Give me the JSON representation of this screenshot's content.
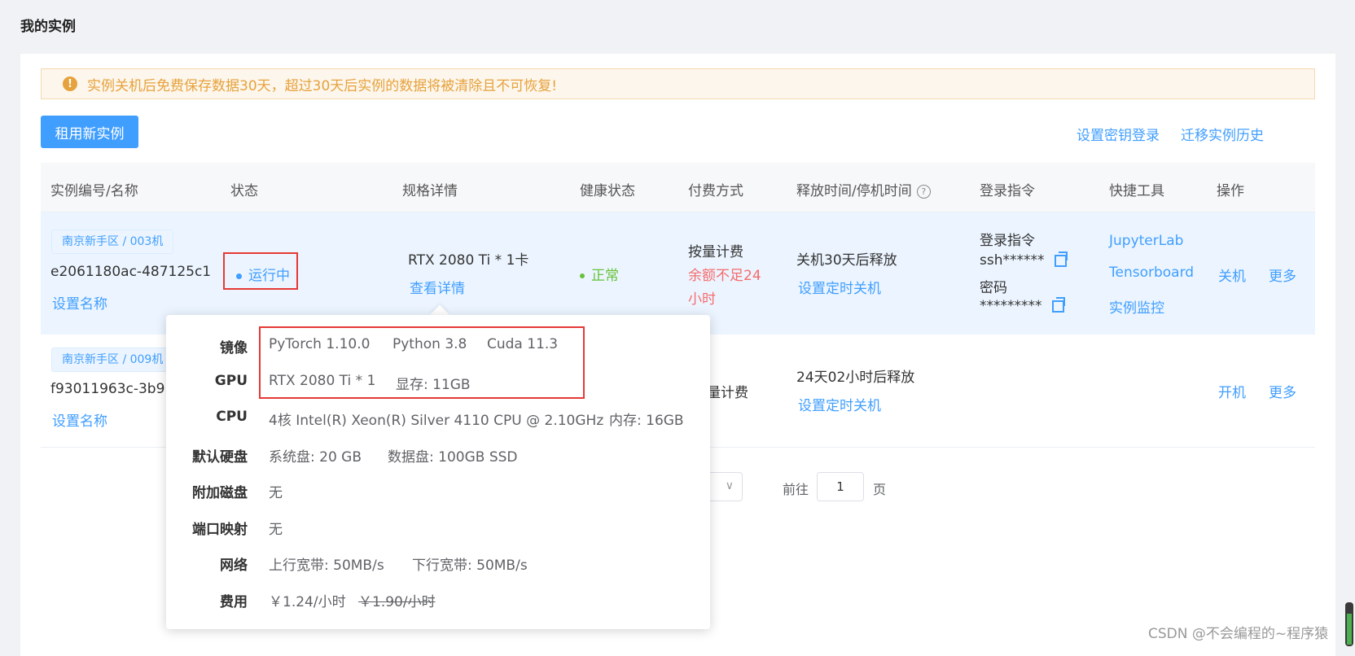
{
  "page": {
    "title": "我的实例"
  },
  "alert": {
    "text": "实例关机后免费保存数据30天，超过30天后实例的数据将被清除且不可恢复!"
  },
  "toolbar": {
    "rent_new": "租用新实例",
    "key_login": "设置密钥登录",
    "migrate_history": "迁移实例历史"
  },
  "table": {
    "headers": {
      "id_name": "实例编号/名称",
      "status": "状态",
      "spec": "规格详情",
      "health": "健康状态",
      "billing": "付费方式",
      "release": "释放时间/停机时间",
      "login": "登录指令",
      "tools": "快捷工具",
      "actions": "操作"
    },
    "rows": [
      {
        "tag": "南京新手区 / 003机",
        "id": "e2061180ac-487125c1",
        "set_name": "设置名称",
        "status": "运行中",
        "spec": "RTX 2080 Ti * 1卡",
        "spec_detail": "查看详情",
        "health": "正常",
        "billing": "按量计费",
        "billing_warn1": "余额不足24",
        "billing_warn2": "小时",
        "release": "关机30天后释放",
        "set_shutdown": "设置定时关机",
        "login_title": "登录指令",
        "ssh": "ssh******",
        "pwd_label": "密码",
        "pwd": "*********",
        "tool1": "JupyterLab",
        "tool2": "Tensorboard",
        "tool3": "实例监控",
        "action1": "关机",
        "action2": "更多"
      },
      {
        "tag": "南京新手区 / 009机",
        "id": "f93011963c-3b9",
        "set_name": "设置名称",
        "billing": "量计费",
        "release": "24天02小时后释放",
        "set_shutdown": "设置定时关机",
        "action1": "开机",
        "action2": "更多"
      }
    ]
  },
  "pagination": {
    "goto": "前往",
    "page_value": "1",
    "page_suffix": "页"
  },
  "popover": {
    "labels": {
      "image": "镜像",
      "gpu": "GPU",
      "cpu": "CPU",
      "disk": "默认硬盘",
      "extra_disk": "附加磁盘",
      "port": "端口映射",
      "network": "网络",
      "fee": "费用"
    },
    "image": {
      "pytorch": "PyTorch  1.10.0",
      "python": "Python  3.8",
      "cuda": "Cuda  11.3"
    },
    "gpu": {
      "model": "RTX 2080 Ti * 1",
      "vram": "显存:  11GB"
    },
    "cpu": {
      "model": "4核 Intel(R) Xeon(R) Silver 4110 CPU @ 2.10GHz",
      "mem": "内存:  16GB"
    },
    "disk": {
      "system": "系统盘:  20 GB",
      "data": "数据盘:  100GB SSD"
    },
    "extra_disk": "无",
    "port": "无",
    "network": {
      "up": "上行宽带:  50MB/s",
      "down": "下行宽带:  50MB/s"
    },
    "fee": {
      "current": "￥1.24/小时",
      "original": "￥1.90/小时"
    }
  },
  "watermark": "CSDN @不会编程的~程序猿",
  "colors": {
    "primary": "#409eff",
    "warning": "#e6a23c",
    "danger": "#f56c6c",
    "success": "#67c23a",
    "highlight_box": "#e53935"
  }
}
